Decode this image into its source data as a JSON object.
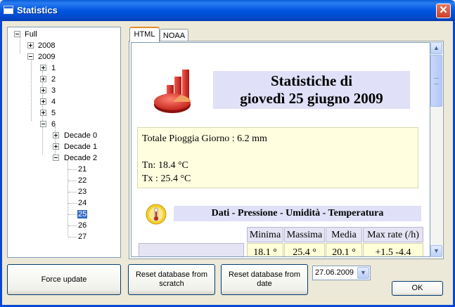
{
  "window": {
    "title": "Statistics",
    "close_glyph": "✕"
  },
  "tree": {
    "root": "Full",
    "year_2008": "2008",
    "year_2009": "2009",
    "months": [
      "1",
      "2",
      "3",
      "4",
      "5",
      "6"
    ],
    "decades": [
      "Decade 0",
      "Decade 1",
      "Decade 2"
    ],
    "days": [
      "21",
      "22",
      "23",
      "24",
      "25",
      "26",
      "27"
    ],
    "selected_day": "25"
  },
  "tabs": [
    {
      "label": "HTML",
      "active": true
    },
    {
      "label": "NOAA",
      "active": false
    }
  ],
  "report": {
    "title_line1": "Statistiche di",
    "title_line2": "giovedì 25 giugno 2009",
    "rain": "Totale Pioggia Giorno : 6.2 mm",
    "tn": "Tn: 18.4 °C",
    "tx": "Tx : 25.4 °C",
    "section_title": "Dati - Pressione - Umidità - Temperatura",
    "table_headers": [
      "Minima",
      "Massima",
      "Media",
      "Max rate (/h)"
    ],
    "table_row": [
      "18.1 °",
      "25.4 °",
      "20.1 °",
      "+1.5  -4.4"
    ]
  },
  "buttons": {
    "force_update": "Force update",
    "reset_scratch": "Reset database from scratch",
    "reset_date": "Reset database from date",
    "ok": "OK"
  },
  "date_picker": {
    "value": "27.06.2009"
  },
  "scroll_icons": {
    "up": "▲",
    "down": "▼"
  }
}
